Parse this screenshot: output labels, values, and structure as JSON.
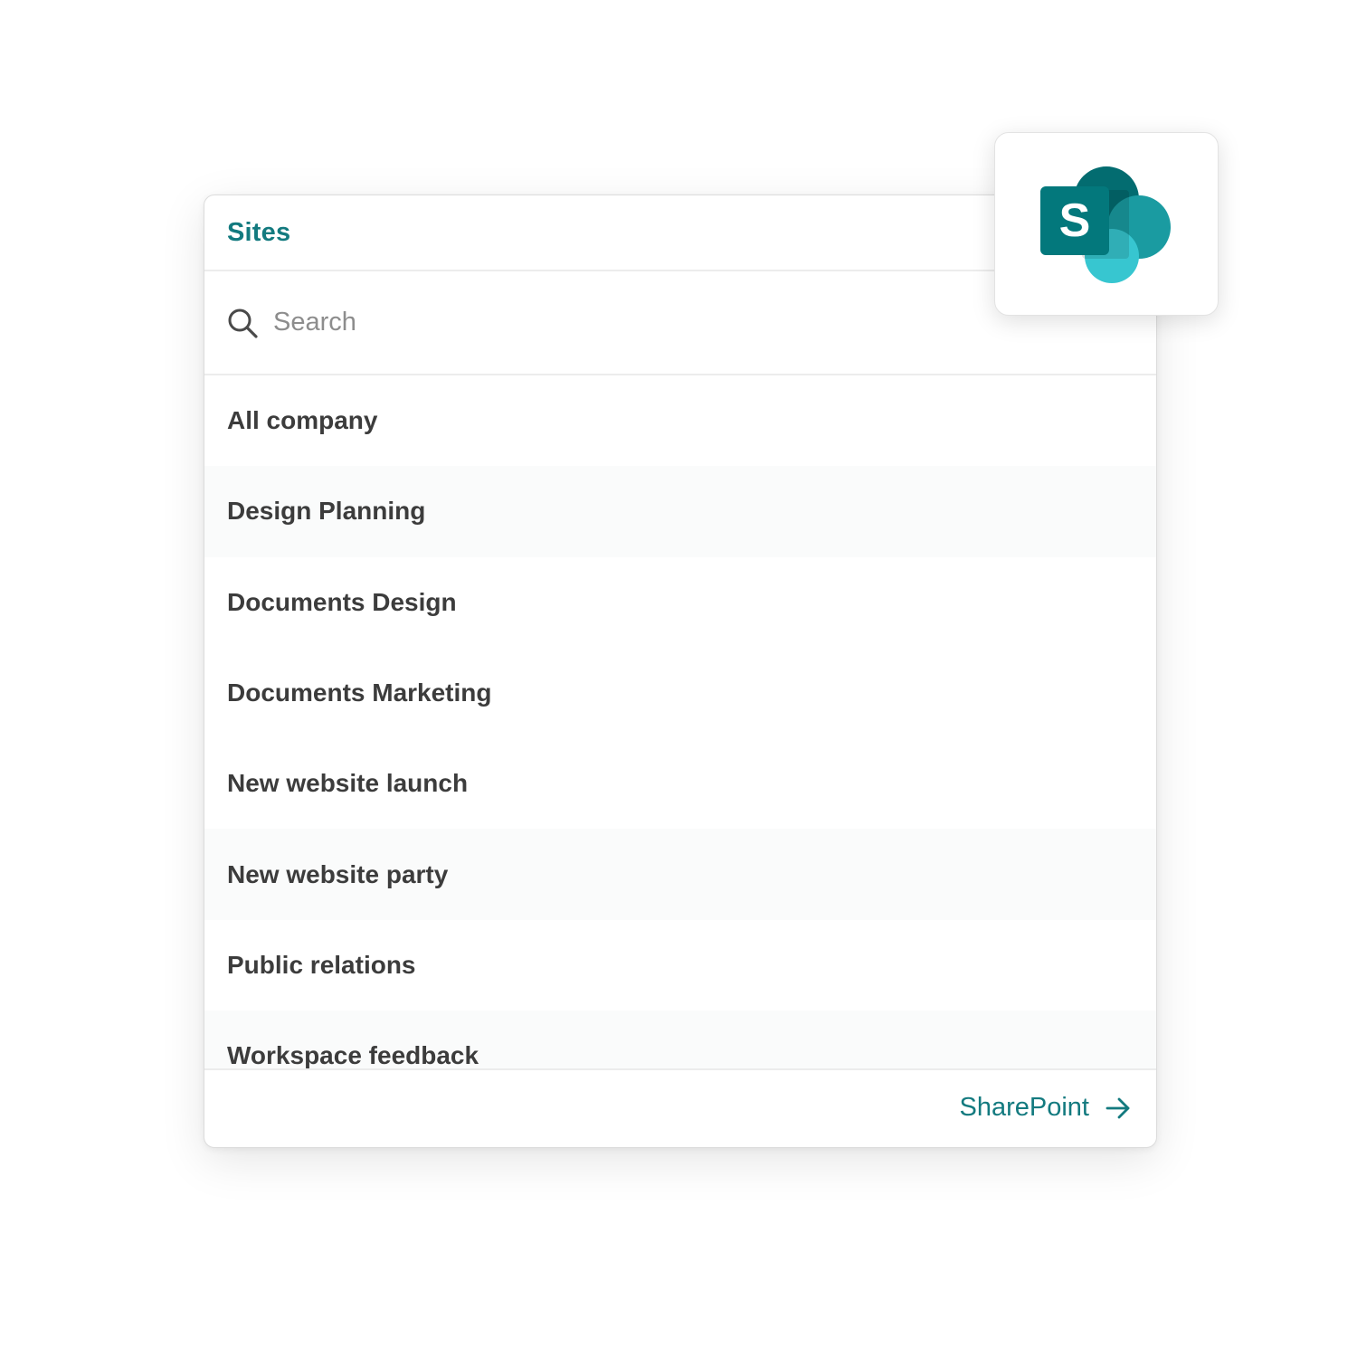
{
  "panel": {
    "title": "Sites"
  },
  "search": {
    "placeholder": "Search",
    "icon": "search-icon"
  },
  "sites": [
    {
      "label": "All company"
    },
    {
      "label": "Design Planning"
    },
    {
      "label": "Documents Design"
    },
    {
      "label": "Documents Marketing"
    },
    {
      "label": "New website launch"
    },
    {
      "label": "New website party"
    },
    {
      "label": "Public relations"
    },
    {
      "label": "Workspace feedback"
    }
  ],
  "footer": {
    "link_label": "SharePoint",
    "icon": "arrow-right-icon"
  },
  "logo": {
    "icon": "sharepoint-logo-icon",
    "letter": "S"
  },
  "colors": {
    "accent": "#137a7f",
    "text": "#3c3c3c",
    "logo_dark": "#036c70",
    "logo_mid": "#1a9ba1",
    "logo_light": "#37c6d0"
  }
}
